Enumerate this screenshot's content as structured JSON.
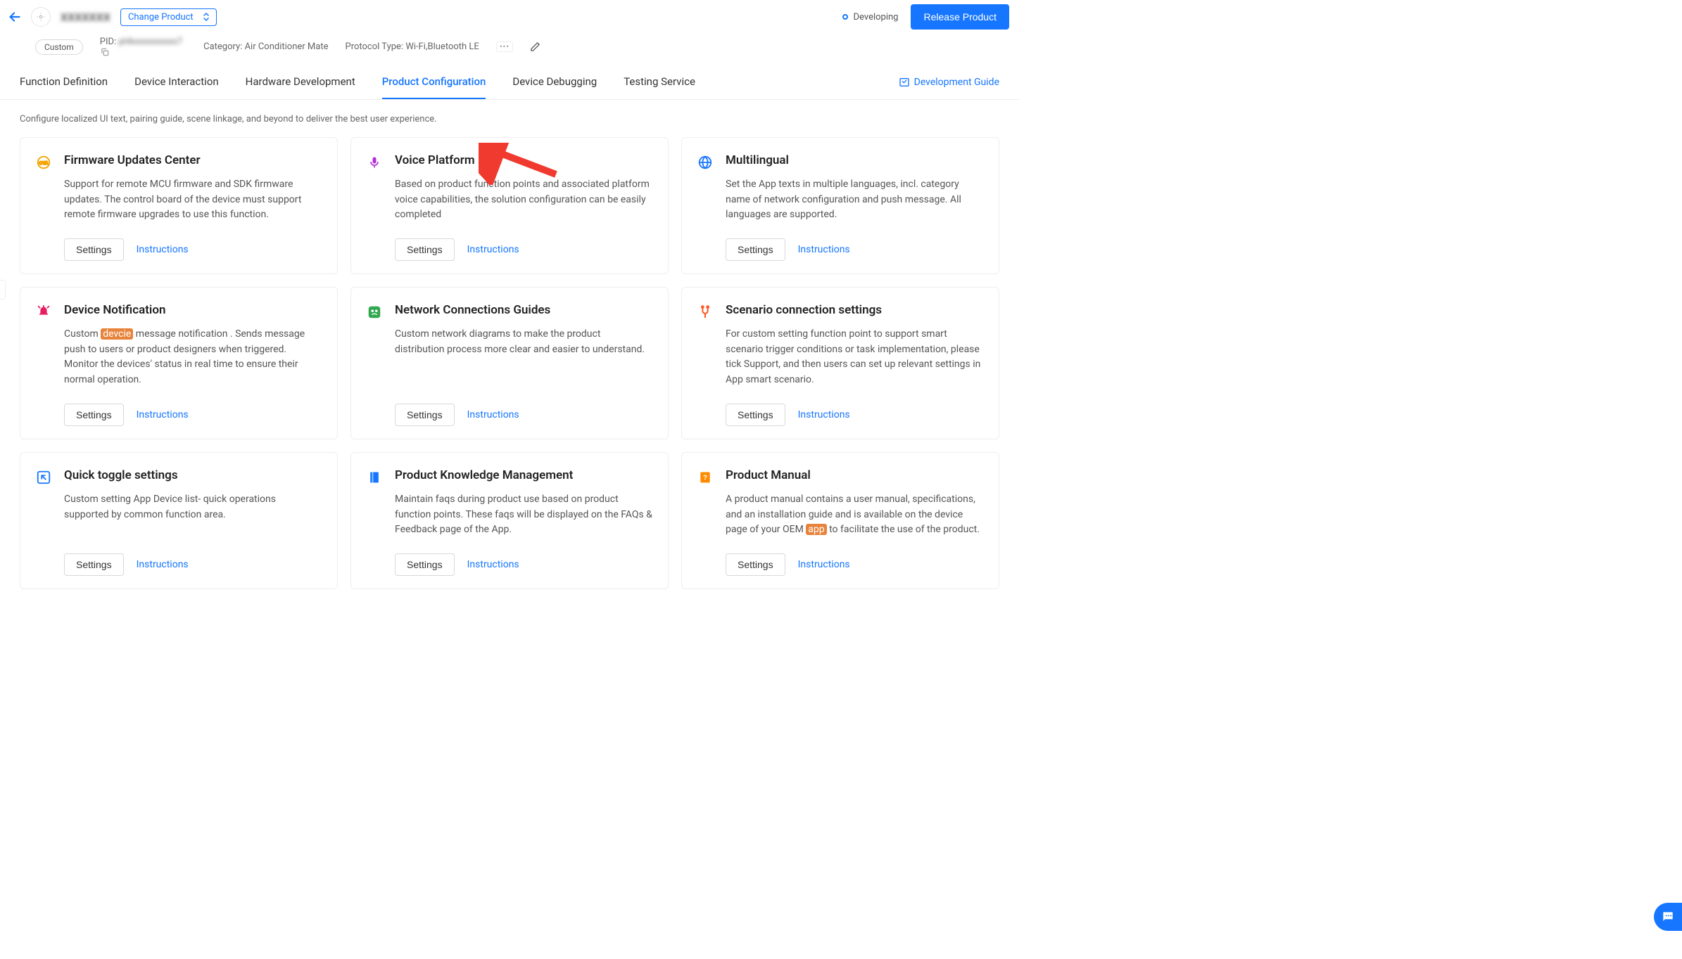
{
  "header": {
    "change_product": "Change Product",
    "status": "Developing",
    "release": "Release Product"
  },
  "meta": {
    "custom_badge": "Custom",
    "pid_label": "PID:",
    "pid_value": "pt4xxxxxxxxxx7",
    "category_label": "Category:",
    "category_value": "Air Conditioner Mate",
    "protocol_label": "Protocol Type:",
    "protocol_value": "Wi-Fi,Bluetooth LE"
  },
  "tabs": [
    {
      "label": "Function Definition",
      "active": false
    },
    {
      "label": "Device Interaction",
      "active": false
    },
    {
      "label": "Hardware Development",
      "active": false
    },
    {
      "label": "Product Configuration",
      "active": true
    },
    {
      "label": "Device Debugging",
      "active": false
    },
    {
      "label": "Testing Service",
      "active": false
    }
  ],
  "dev_guide": "Development Guide",
  "page_description": "Configure localized UI text, pairing guide, scene linkage, and beyond to deliver the best user experience.",
  "common": {
    "settings": "Settings",
    "instructions": "Instructions"
  },
  "cards": [
    {
      "icon": "ota-icon",
      "title": "Firmware Updates Center",
      "desc": "Support for remote MCU firmware and SDK firmware updates. The control board of the device must support remote firmware upgrades to use this function."
    },
    {
      "icon": "mic-icon",
      "title": "Voice Platform",
      "desc": "Based on product function points and associated platform voice capabilities, the solution configuration can be easily completed"
    },
    {
      "icon": "globe-icon",
      "title": "Multilingual",
      "desc": "Set the App texts in multiple languages, incl. category name of network configuration and push message. All languages are supported."
    },
    {
      "icon": "bell-icon",
      "title": "Device Notification",
      "desc_pre": "Custom ",
      "desc_hl": "devcie",
      "desc_post": " message notification . Sends message push to users or product designers when triggered. Monitor the devices' status in real time to ensure their normal operation."
    },
    {
      "icon": "network-icon",
      "title": "Network Connections Guides",
      "desc": "Custom network diagrams to make the product distribution process more clear and easier to understand."
    },
    {
      "icon": "scenario-icon",
      "title": "Scenario connection settings",
      "desc": "For custom setting function point to support smart scenario trigger conditions or task implementation, please tick Support, and then users can set up relevant settings in App smart scenario."
    },
    {
      "icon": "toggle-icon",
      "title": "Quick toggle settings",
      "desc": "Custom setting App Device list- quick operations supported by common function area."
    },
    {
      "icon": "book-icon",
      "title": "Product Knowledge Management",
      "desc": "Maintain faqs during product use based on product function points. These faqs will be displayed on the FAQs & Feedback page of the App."
    },
    {
      "icon": "manual-icon",
      "title": "Product Manual",
      "desc_pre": "A product manual contains a user manual, specifications, and an installation guide and is available on the device page of your OEM ",
      "desc_hl": "app",
      "desc_post": " to facilitate the use of the product."
    }
  ]
}
